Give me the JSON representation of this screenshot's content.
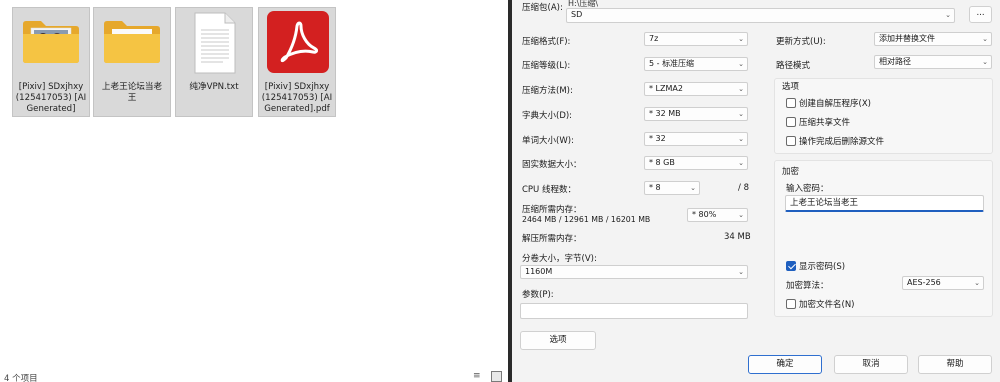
{
  "explorer": {
    "items": [
      {
        "name": "[Pixiv] SDxjhxy (125417053) [AI Generated]",
        "lines": [
          "[Pixiv] SDxjhxy",
          "(125417053) [AI",
          "Generated]"
        ],
        "type": "folder-with-images"
      },
      {
        "name": "上老王论坛当老王",
        "lines": [
          "上老王论坛当老",
          "王"
        ],
        "type": "folder"
      },
      {
        "name": "纯净VPN.txt",
        "lines": [
          "纯净VPN.txt"
        ],
        "type": "text"
      },
      {
        "name": "[Pixiv] SDxjhxy (125417053) [AI Generated].pdf",
        "lines": [
          "[Pixiv] SDxjhxy",
          "(125417053) [AI",
          "Generated].pdf"
        ],
        "type": "pdf"
      }
    ],
    "status": "4 个项目",
    "colors": {
      "folder": "#f5c443",
      "pdf": "#d32020",
      "selection": "#d9d9d9"
    }
  },
  "dialog": {
    "archive_label": "压缩包(A):",
    "archive_sublabel": "H:\\压缩\\",
    "archive_value": "SD",
    "browse_label": "...",
    "format_label": "压缩格式(F):",
    "format_value": "7z",
    "level_label": "压缩等级(L):",
    "level_value": "5 - 标准压缩",
    "method_label": "压缩方法(M):",
    "method_value": "* LZMA2",
    "dict_label": "字典大小(D):",
    "dict_value": "* 32 MB",
    "word_label": "单词大小(W):",
    "word_value": "* 32",
    "solid_label": "固实数据大小：",
    "solid_value": "* 8 GB",
    "threads_label": "CPU 线程数：",
    "threads_value": "* 8",
    "threads_max": "/ 8",
    "mem_comp_label": "压缩所需内存：",
    "mem_comp_detail": "2464 MB / 12961 MB / 16201 MB",
    "mem_percent": "* 80%",
    "mem_decomp_label": "解压所需内存：",
    "mem_decomp_value": "34 MB",
    "split_label": "分卷大小，字节(V):",
    "split_value": "1160M",
    "params_label": "参数(P):",
    "params_value": "",
    "options_button": "选项",
    "update_label": "更新方式(U):",
    "update_value": "添加并替换文件",
    "path_label": "路径模式",
    "path_value": "相对路径",
    "options_group": "选项",
    "opt_sfx": "创建自解压程序(X)",
    "opt_shared": "压缩共享文件",
    "opt_delete": "操作完成后删除源文件",
    "encrypt_group": "加密",
    "password_label": "输入密码：",
    "password_value": "上老王论坛当老王",
    "show_password": "显示密码(S)",
    "enc_method_label": "加密算法：",
    "enc_method_value": "AES-256",
    "encrypt_names": "加密文件名(N)",
    "ok_button": "确定",
    "cancel_button": "取消",
    "help_button": "帮助",
    "accent": "#1f5fbf"
  }
}
